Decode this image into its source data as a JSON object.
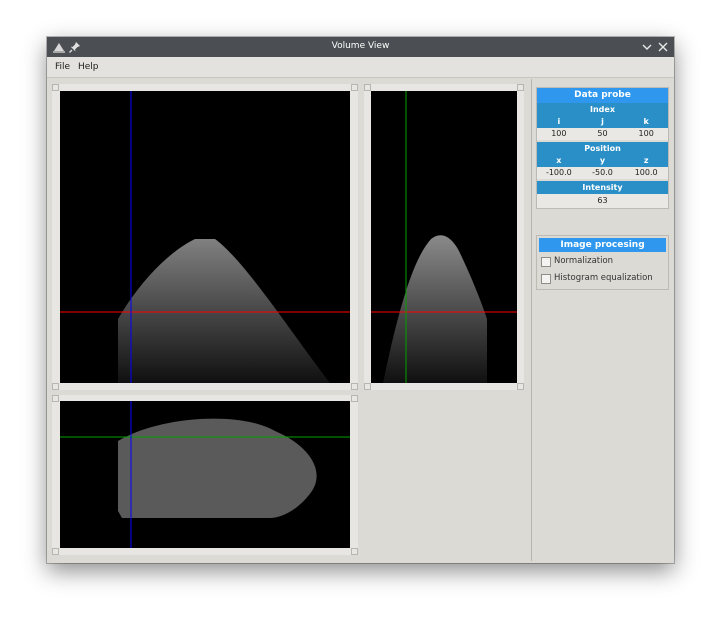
{
  "window": {
    "title": "Volume View"
  },
  "menu": {
    "items": [
      "File",
      "Help"
    ]
  },
  "data_probe": {
    "title": "Data probe",
    "index": {
      "label": "Index",
      "columns": [
        "i",
        "j",
        "k"
      ],
      "values": [
        "100",
        "50",
        "100"
      ]
    },
    "position": {
      "label": "Position",
      "columns": [
        "x",
        "y",
        "z"
      ],
      "values": [
        "-100.0",
        "-50.0",
        "100.0"
      ]
    },
    "intensity": {
      "label": "Intensity",
      "value": "63"
    }
  },
  "image_processing": {
    "title": "Image procesing",
    "options": [
      {
        "label": "Normalization",
        "checked": false
      },
      {
        "label": "Histogram equalization",
        "checked": false
      }
    ]
  },
  "colors": {
    "crosshair_red": "#ff0000",
    "crosshair_blue": "#0000ff",
    "crosshair_green": "#00a000",
    "panel_header": "#2f98ee",
    "panel_subheader": "#2a8fc7"
  }
}
